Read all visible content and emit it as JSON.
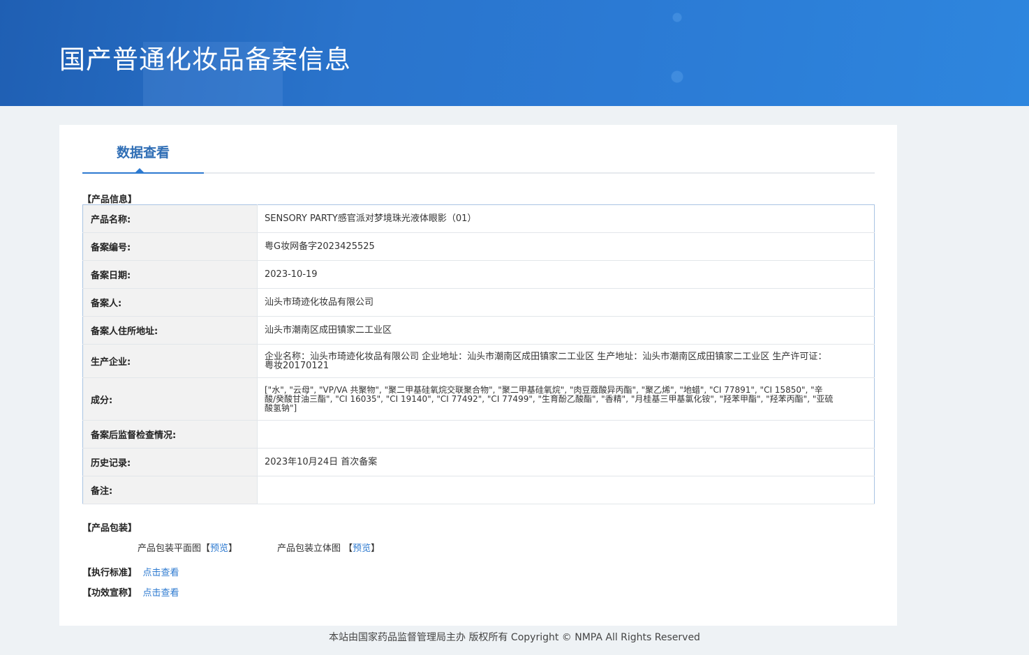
{
  "header": {
    "title": "国产普通化妆品备案信息"
  },
  "tabs": [
    {
      "label": "数据查看"
    }
  ],
  "product_info": {
    "section_label": "【产品信息】",
    "rows": [
      {
        "key": "产品名称:",
        "value": "SENSORY PARTY感官派对梦境珠光液体眼影（01）"
      },
      {
        "key": "备案编号:",
        "value": "粤G妆网备字2023425525"
      },
      {
        "key": "备案日期:",
        "value": "2023-10-19"
      },
      {
        "key": "备案人:",
        "value": "汕头市琦迹化妆品有限公司"
      },
      {
        "key": "备案人住所地址:",
        "value": "汕头市潮南区成田镇家二工业区"
      },
      {
        "key": "生产企业:",
        "value": "企业名称：汕头市琦迹化妆品有限公司 企业地址：汕头市潮南区成田镇家二工业区 生产地址：汕头市潮南区成田镇家二工业区 生产许可证：粤妆20170121"
      },
      {
        "key": "成分:",
        "value": "[\"水\", \"云母\", \"VP/VA 共聚物\", \"聚二甲基硅氧烷交联聚合物\", \"聚二甲基硅氧烷\", \"肉豆蔻酸异丙酯\", \"聚乙烯\", \"地蜡\", \"CI 77891\", \"CI 15850\", \"辛酸/癸酸甘油三酯\", \"CI 16035\", \"CI 19140\", \"CI 77492\", \"CI 77499\", \"生育酚乙酸酯\", \"香精\", \"月桂基三甲基氯化铵\", \"羟苯甲酯\", \"羟苯丙酯\", \"亚硫酸氢钠\"]"
      },
      {
        "key": "备案后监督检查情况:",
        "value": ""
      },
      {
        "key": "历史记录:",
        "value": "2023年10月24日 首次备案"
      },
      {
        "key": "备注:",
        "value": ""
      }
    ]
  },
  "packaging": {
    "section_label": "【产品包装】",
    "flat_label": "产品包装平面图【",
    "flat_link": "预览",
    "flat_close": "】",
    "solid_label": "产品包装立体图 【",
    "solid_link": "预览",
    "solid_close": "】"
  },
  "standard": {
    "label": "【执行标准】",
    "link": "点击查看"
  },
  "efficacy": {
    "label": "【功效宣称】",
    "link": "点击查看"
  },
  "footer": {
    "text": "本站由国家药品监督管理局主办 版权所有 Copyright © NMPA All Rights Reserved"
  }
}
